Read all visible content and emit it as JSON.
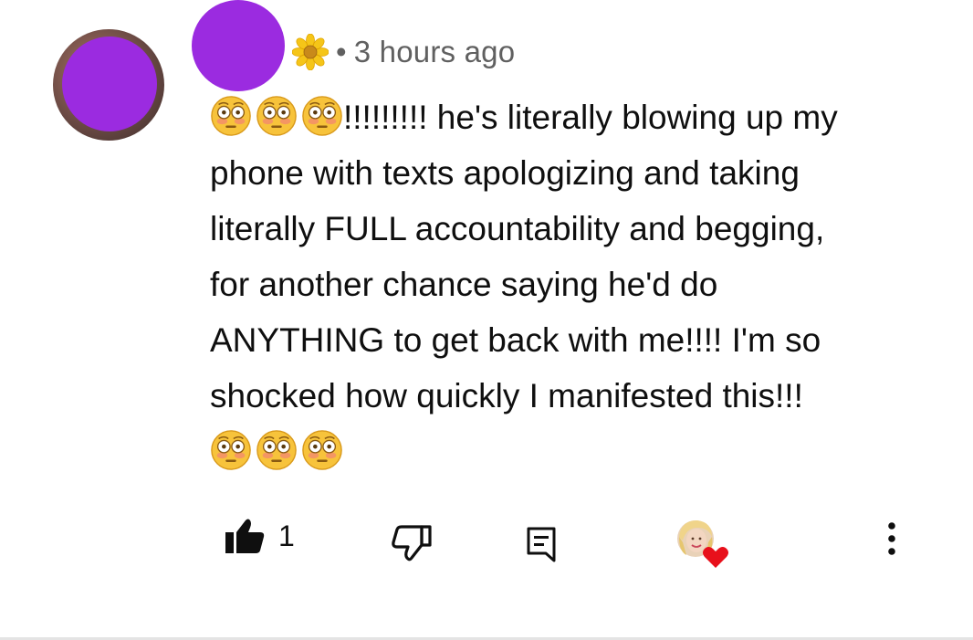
{
  "comment": {
    "timestamp": "3 hours ago",
    "separator": "•",
    "badge_icon": "sunflower-emoji",
    "lines": [
      "!!!!!!!!! he's literally blowing up my",
      "phone with texts apologizing and taking",
      "literally FULL accountability and begging,",
      "for another chance saying he'd do",
      "ANYTHING to get back with me!!!! I'm so",
      "shocked how quickly I manifested this!!!"
    ],
    "leading_emoji": "flushed-face",
    "trailing_emoji": "flushed-face"
  },
  "actions": {
    "like_count": "1",
    "like_icon": "thumbs-up-filled-icon",
    "dislike_icon": "thumbs-down-outline-icon",
    "reply_icon": "reply-comment-icon",
    "hearted_badge": "creator-heart-icon",
    "more_icon": "more-vertical-icon"
  },
  "colors": {
    "redaction": "#9b2be0",
    "meta_text": "#606060",
    "heart": "#e8101b"
  }
}
